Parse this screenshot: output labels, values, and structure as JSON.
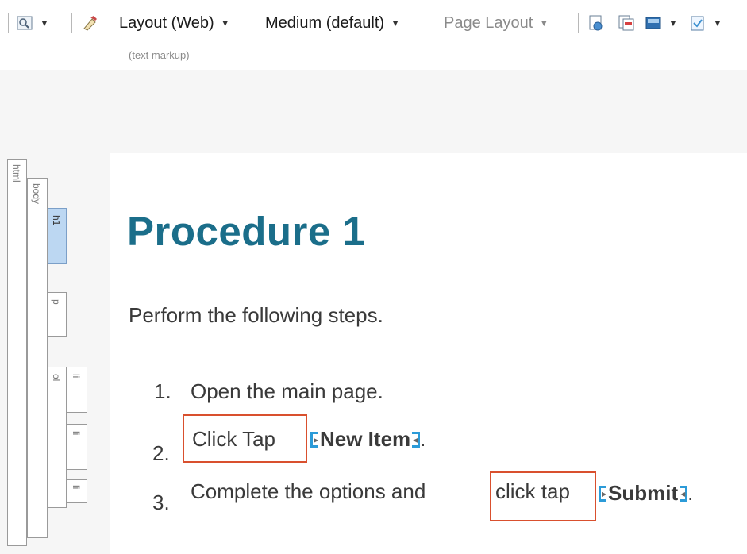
{
  "toolbar": {
    "layout_dropdown": "Layout (Web)",
    "medium_dropdown": "Medium (default)",
    "page_layout_dropdown": "Page Layout",
    "view_mode_caption": "(text markup)"
  },
  "tag_bar": {
    "html": "html",
    "body": "body",
    "h1": "h1",
    "p": "p",
    "ol": "ol",
    "li": "li"
  },
  "document": {
    "heading": "Procedure 1",
    "intro": "Perform the following steps.",
    "steps": [
      {
        "number": "1.",
        "text": "Open the main page."
      },
      {
        "number": "2.",
        "boxed_text": "Click Tap",
        "ui_label": "New Item",
        "after": "."
      },
      {
        "number": "3.",
        "text_before": "Complete the options and",
        "boxed_text": "click tap",
        "ui_label": "Submit",
        "after": "."
      }
    ]
  },
  "colors": {
    "heading": "#1b6e8a",
    "highlight_box": "#d9502e",
    "ui_bracket": "#2c9bd8",
    "selected_tag": "#bcd7f2"
  }
}
